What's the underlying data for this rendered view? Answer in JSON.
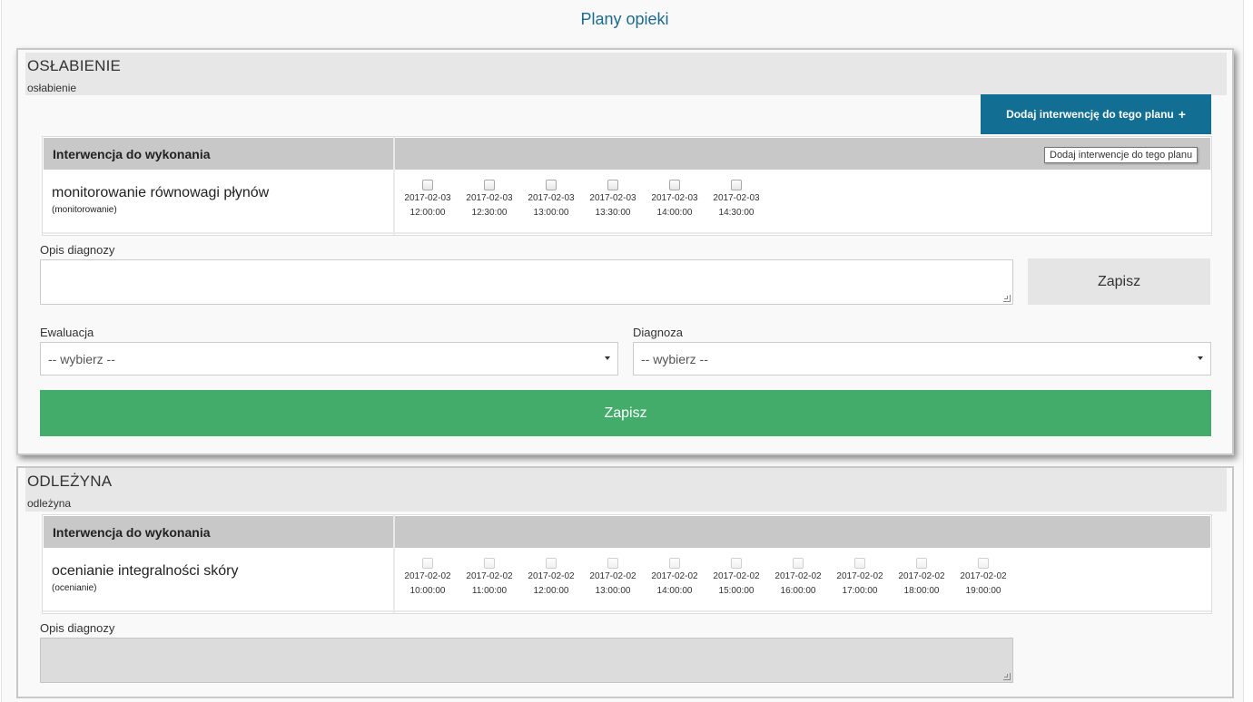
{
  "page": {
    "title": "Plany opieki"
  },
  "plans": [
    {
      "title": "OSŁABIENIE",
      "subtitle": "osłabienie",
      "add_button": "Dodaj interwencję do tego planu",
      "add_icon": "plus-icon",
      "tooltip": "Dodaj interwencje do tego planu",
      "table_header": "Interwencja do wykonania",
      "intervention": {
        "name": "monitorowanie równowagi płynów",
        "type": "(monitorowanie)"
      },
      "slots": [
        {
          "date": "2017-02-03",
          "time": "12:00:00"
        },
        {
          "date": "2017-02-03",
          "time": "12:30:00"
        },
        {
          "date": "2017-02-03",
          "time": "13:00:00"
        },
        {
          "date": "2017-02-03",
          "time": "13:30:00"
        },
        {
          "date": "2017-02-03",
          "time": "14:00:00"
        },
        {
          "date": "2017-02-03",
          "time": "14:30:00"
        }
      ],
      "description_label": "Opis diagnozy",
      "save_small": "Zapisz",
      "evaluation_label": "Ewaluacja",
      "evaluation_value": "-- wybierz --",
      "diagnosis_label": "Diagnoza",
      "diagnosis_value": "-- wybierz --",
      "save_main": "Zapisz"
    },
    {
      "title": "ODLEŻYNA",
      "subtitle": "odleżyna",
      "table_header": "Interwencja do wykonania",
      "intervention": {
        "name": "ocenianie integralności skóry",
        "type": "(ocenianie)"
      },
      "slots": [
        {
          "date": "2017-02-02",
          "time": "10:00:00"
        },
        {
          "date": "2017-02-02",
          "time": "11:00:00"
        },
        {
          "date": "2017-02-02",
          "time": "12:00:00"
        },
        {
          "date": "2017-02-02",
          "time": "13:00:00"
        },
        {
          "date": "2017-02-02",
          "time": "14:00:00"
        },
        {
          "date": "2017-02-02",
          "time": "15:00:00"
        },
        {
          "date": "2017-02-02",
          "time": "16:00:00"
        },
        {
          "date": "2017-02-02",
          "time": "17:00:00"
        },
        {
          "date": "2017-02-02",
          "time": "18:00:00"
        },
        {
          "date": "2017-02-02",
          "time": "19:00:00"
        }
      ],
      "description_label": "Opis diagnozy"
    }
  ],
  "colors": {
    "title": "#1e6a8e",
    "add_button": "#126e93",
    "save_main": "#43ac6a",
    "header_gray": "#c8c8c8"
  }
}
